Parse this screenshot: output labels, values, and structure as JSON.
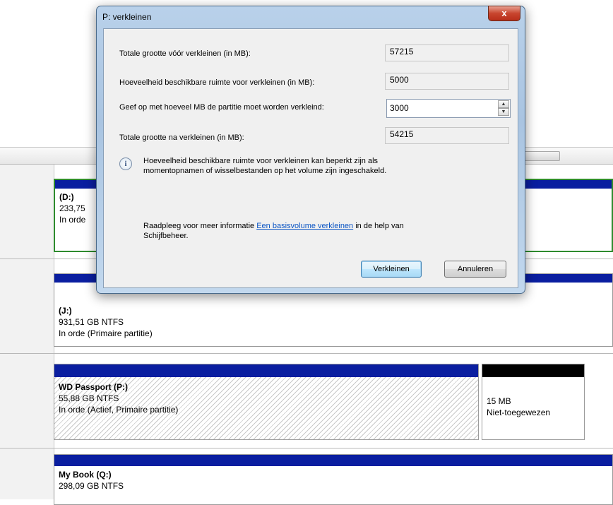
{
  "dialog": {
    "title": "P: verkleinen",
    "close_glyph": "x",
    "total_before_label": "Totale grootte vóór verkleinen (in MB):",
    "total_before_value": "57215",
    "available_label": "Hoeveelheid beschikbare ruimte voor verkleinen (in MB):",
    "available_value": "5000",
    "shrink_label": "Geef op met hoeveel MB de partitie moet worden verkleind:",
    "shrink_value": "3000",
    "total_after_label": "Totale grootte na verkleinen (in MB):",
    "total_after_value": "54215",
    "info_line1": "Hoeveelheid beschikbare ruimte voor verkleinen kan beperkt zijn als",
    "info_line2": "momentopnamen of wisselbestanden op het volume zijn ingeschakeld.",
    "help_prefix": "Raadpleeg voor meer informatie ",
    "help_link": "Een basisvolume verkleinen",
    "help_suffix": " in de help van",
    "help_line2": "Schijfbeheer.",
    "shrink_button": "Verkleinen",
    "cancel_button": "Annuleren"
  },
  "volumes": {
    "d": {
      "name": "(D:)",
      "size": "233,75",
      "status": "In orde"
    },
    "j": {
      "name": "(J:)",
      "size": "931,51 GB NTFS",
      "status": "In orde (Primaire partitie)"
    },
    "p": {
      "name": "WD Passport  (P:)",
      "size": "55,88 GB NTFS",
      "status": "In orde (Actief, Primaire partitie)"
    },
    "unalloc": {
      "size": "15 MB",
      "status": "Niet-toegewezen"
    },
    "q": {
      "name": "My Book  (Q:)",
      "size": "298,09 GB NTFS"
    }
  },
  "colors": {
    "primary_bar": "#0a1ea0",
    "unallocated_bar": "#000000",
    "selected_border": "#2e8b2e",
    "link": "#0b55c4"
  }
}
